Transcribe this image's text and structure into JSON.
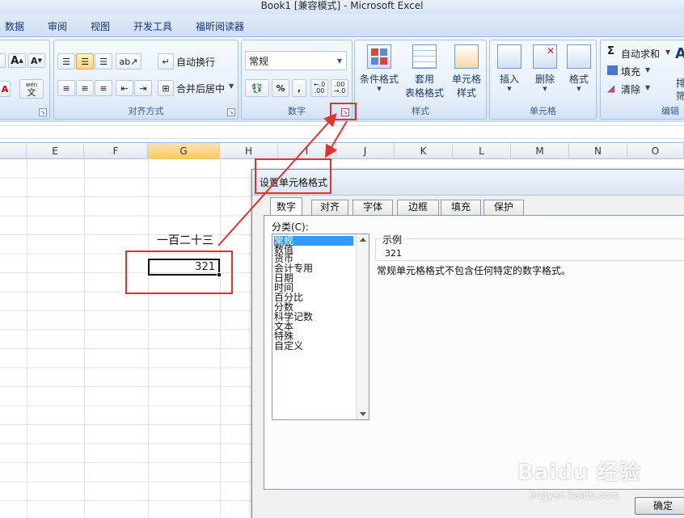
{
  "window": {
    "title": "Book1  [兼容模式] - Microsoft Excel"
  },
  "menu": [
    "数据",
    "审阅",
    "视图",
    "开发工具",
    "福昕阅读器"
  ],
  "ribbon": {
    "font_group": {
      "grow_label": "A",
      "shrink_label": "A",
      "wen_label": "文",
      "wen_top": "wén"
    },
    "alignment": {
      "label": "对齐方式",
      "wrap_text": "自动换行",
      "merge_center": "合并后居中"
    },
    "number": {
      "label": "数字",
      "format_value": "常规",
      "percent": "%",
      "comma": ",",
      "inc_decimal": ".00",
      "dec_decimal": ".00"
    },
    "styles": {
      "label": "样式",
      "conditional": "条件格式",
      "table_top": "套用",
      "table_bottom": "表格格式",
      "cell_top": "单元格",
      "cell_bottom": "样式"
    },
    "cells": {
      "label": "单元格",
      "insert": "插入",
      "delete": "删除",
      "format": "格式"
    },
    "editing": {
      "label": "编辑",
      "autosum": "自动求和",
      "fill": "填充",
      "clear": "清除",
      "sort_partial": "排",
      "sort_partial2": "筛",
      "sigma": "Σ"
    }
  },
  "sheet": {
    "columns": [
      "E",
      "F",
      "G",
      "H",
      "I",
      "J",
      "K",
      "L",
      "M",
      "N",
      "O"
    ],
    "selected_column": "G",
    "cell_label": "一百二十三",
    "cell_value": "321"
  },
  "dialog": {
    "title": "设置单元格格式",
    "tabs": [
      "数字",
      "对齐",
      "字体",
      "边框",
      "填充",
      "保护"
    ],
    "active_tab": "数字",
    "category_label": "分类(C):",
    "categories": [
      "常规",
      "数值",
      "货币",
      "会计专用",
      "日期",
      "时间",
      "百分比",
      "分数",
      "科学记数",
      "文本",
      "特殊",
      "自定义"
    ],
    "selected_category": "常规",
    "sample_label": "示例",
    "sample_value": "321",
    "description": "常规单元格格式不包含任何特定的数字格式。",
    "ok_label": "确定"
  },
  "watermark": {
    "brand": "Baidu 经验",
    "url": "jingyan.baidu.com"
  },
  "colors": {
    "annotation_red": "#e53030",
    "selection_blue": "#3399ff",
    "ribbon_text": "#1e3a72"
  }
}
